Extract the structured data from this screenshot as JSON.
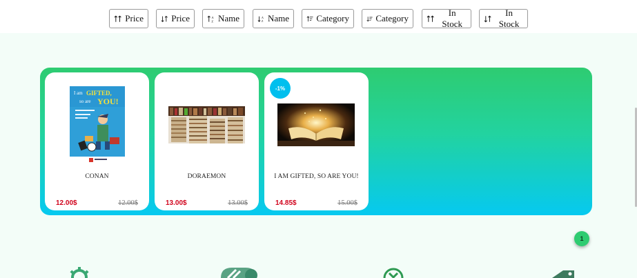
{
  "sort_buttons": [
    {
      "label": "Price",
      "dir": "asc",
      "icon": "sort-ascending-icon"
    },
    {
      "label": "Price",
      "dir": "desc",
      "icon": "sort-descending-icon"
    },
    {
      "label": "Name",
      "dir": "asc",
      "icon": "sort-alpha-ascending-icon"
    },
    {
      "label": "Name",
      "dir": "desc",
      "icon": "sort-alpha-descending-icon"
    },
    {
      "label": "Category",
      "dir": "asc",
      "icon": "sort-list-ascending-icon"
    },
    {
      "label": "Category",
      "dir": "desc",
      "icon": "sort-list-descending-icon"
    },
    {
      "label": "In Stock",
      "dir": "asc",
      "icon": "sort-ascending-icon"
    },
    {
      "label": "In Stock",
      "dir": "desc",
      "icon": "sort-descending-icon"
    }
  ],
  "products": [
    {
      "title": "CONAN",
      "price": "12.00$",
      "old_price": "12.00$",
      "badge": "",
      "image": "book-cover-i-am-gifted"
    },
    {
      "title": "DORAEMON",
      "price": "13.00$",
      "old_price": "13.00$",
      "badge": "",
      "image": "stacked-books-photo"
    },
    {
      "title": "I AM GIFTED, SO ARE YOU!",
      "price": "14.85$",
      "old_price": "15.00$",
      "badge": "-1%",
      "image": "glowing-open-book-photo"
    }
  ],
  "pagination": {
    "current_page": "1"
  },
  "colors": {
    "panel_gradient_top": "#2ecc71",
    "panel_gradient_bottom": "#06c9f0",
    "price": "#d0021b",
    "badge": "#00bfee",
    "pager": "#2ecc71",
    "feature_icon": "#3aa873"
  },
  "features": [
    {
      "icon": "gear-icon"
    },
    {
      "icon": "toggle-icon"
    },
    {
      "icon": "circle-check-icon"
    },
    {
      "icon": "tag-icon"
    }
  ]
}
